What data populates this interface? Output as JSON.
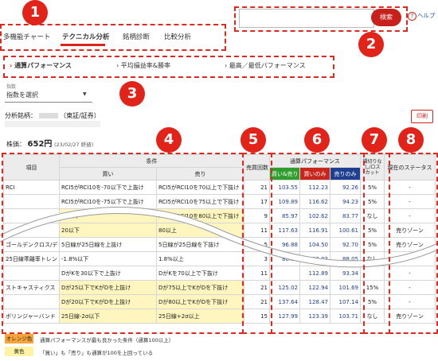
{
  "nav": {
    "tabs": [
      "多機能チャート",
      "テクニカル分析",
      "銘柄診断",
      "比較分析"
    ],
    "active_tab": "テクニカル分析",
    "search_placeholder": "",
    "search_button": "検索",
    "help": "ヘルプ"
  },
  "subtabs": [
    "通算パフォーマンス",
    "平均損益率&勝率",
    "最高／最低パフォーマンス"
  ],
  "index_select": {
    "label": "指数",
    "value": "指数を選択"
  },
  "stock": {
    "name_label": "分析銘柄：",
    "name_suffix": "（東証/証券）",
    "price_label": "株価：",
    "price": "652円",
    "date": "(23/02/27 終値)"
  },
  "print_button": "印刷",
  "table": {
    "headers": {
      "item": "項目",
      "condition": "条件",
      "buy": "買い",
      "sell": "売り",
      "count": "売買回数",
      "perf": "通算パフォーマンス",
      "buy_sell": "買い&売り",
      "buy_only": "買いのみ",
      "sell_only": "売りのみ",
      "loss_cut": "損切りなし/ロスカット",
      "status": "現在のステータス"
    },
    "rows": [
      {
        "item": "RCI",
        "buy": "RCI5がRCI10を-70以下で上抜け",
        "sell": "RCI5がRCI10を70以上で下抜け",
        "count": "21",
        "bs": "103.55",
        "b": "112.23",
        "s": "92.26",
        "cut": "5%",
        "status": "-",
        "hl": false
      },
      {
        "item": "",
        "buy": "RCI5がRCI10を-75以下で上抜け",
        "sell": "RCI5がRCI10を75以上で下抜け",
        "count": "17",
        "bs": "109.89",
        "b": "116.62",
        "s": "94.23",
        "cut": "5%",
        "status": "-",
        "hl": false
      },
      {
        "item": "",
        "buy": "25以下",
        "sell": "RCI5がRCI10を80以上で下抜け",
        "count": "9",
        "bs": "85.97",
        "b": "102.62",
        "s": "83.77",
        "cut": "なし",
        "status": "-",
        "hl": true
      },
      {
        "item": "",
        "buy": "20以下",
        "sell": "80以上",
        "count": "11",
        "bs": "117.63",
        "b": "116.91",
        "s": "100.61",
        "cut": "5%",
        "status": "売りゾーン",
        "hl": true
      },
      {
        "item": "ゴールデンクロス/デッドクロス",
        "buy": "5日線が25日線を上抜け",
        "sell": "5日線が25日線を下抜け",
        "count": "5",
        "bs": "96.88",
        "b": "104.50",
        "s": "92.70",
        "cut": "5%",
        "status": "売りゾーン",
        "hl": false
      },
      {
        "item": "25日線乖離率トレンド",
        "buy": "-1.8%以下",
        "sell": "1.8%以上",
        "count": "3",
        "bs": "88.68",
        "b": "100.83",
        "s": "88.05",
        "cut": "なし",
        "status": "-",
        "hl": false
      },
      {
        "item": "",
        "buy": "DがKを30以下で上抜け",
        "sell": "DがKを70以上で下抜け",
        "count": "11",
        "bs": "",
        "b": "112.89",
        "s": "93.34",
        "cut": "",
        "status": "-",
        "hl": false
      },
      {
        "item": "ストキャスティクス",
        "buy": "Dが25以下でKがDを上抜け",
        "sell": "Dが75以上でKがDを下抜け",
        "count": "21",
        "bs": "125.02",
        "b": "122.94",
        "s": "101.69",
        "cut": "15%",
        "status": "-",
        "hl": true
      },
      {
        "item": "",
        "buy": "Dが20以下でKがDを上抜け",
        "sell": "Dが80以上でKがDを下抜け",
        "count": "21",
        "bs": "137.64",
        "b": "128.47",
        "s": "107.14",
        "cut": "5%",
        "status": "-",
        "hl": true
      },
      {
        "item": "ボリンジャーバンド",
        "buy": "25日線-2σ以下",
        "sell": "25日線+2σ以上",
        "count": "15",
        "bs": "127.99",
        "b": "123.39",
        "s": "103.71",
        "cut": "なし",
        "status": "売りゾーン",
        "hl": true
      }
    ]
  },
  "legend": [
    {
      "label": "オレンジ色",
      "text": "通算パフォーマンスが最も良かった条件（通算100以上）",
      "color": "#f5a53a"
    },
    {
      "label": "黄色",
      "text": "「買い」も「売り」も通算が100を上回っている",
      "color": "#fff3a6"
    }
  ],
  "badges": [
    "1",
    "2",
    "3",
    "4",
    "5",
    "6",
    "7",
    "8"
  ],
  "colors": {
    "accent": "#e2231a",
    "navy": "#1f3f91",
    "highlight": "#fff6bf"
  }
}
